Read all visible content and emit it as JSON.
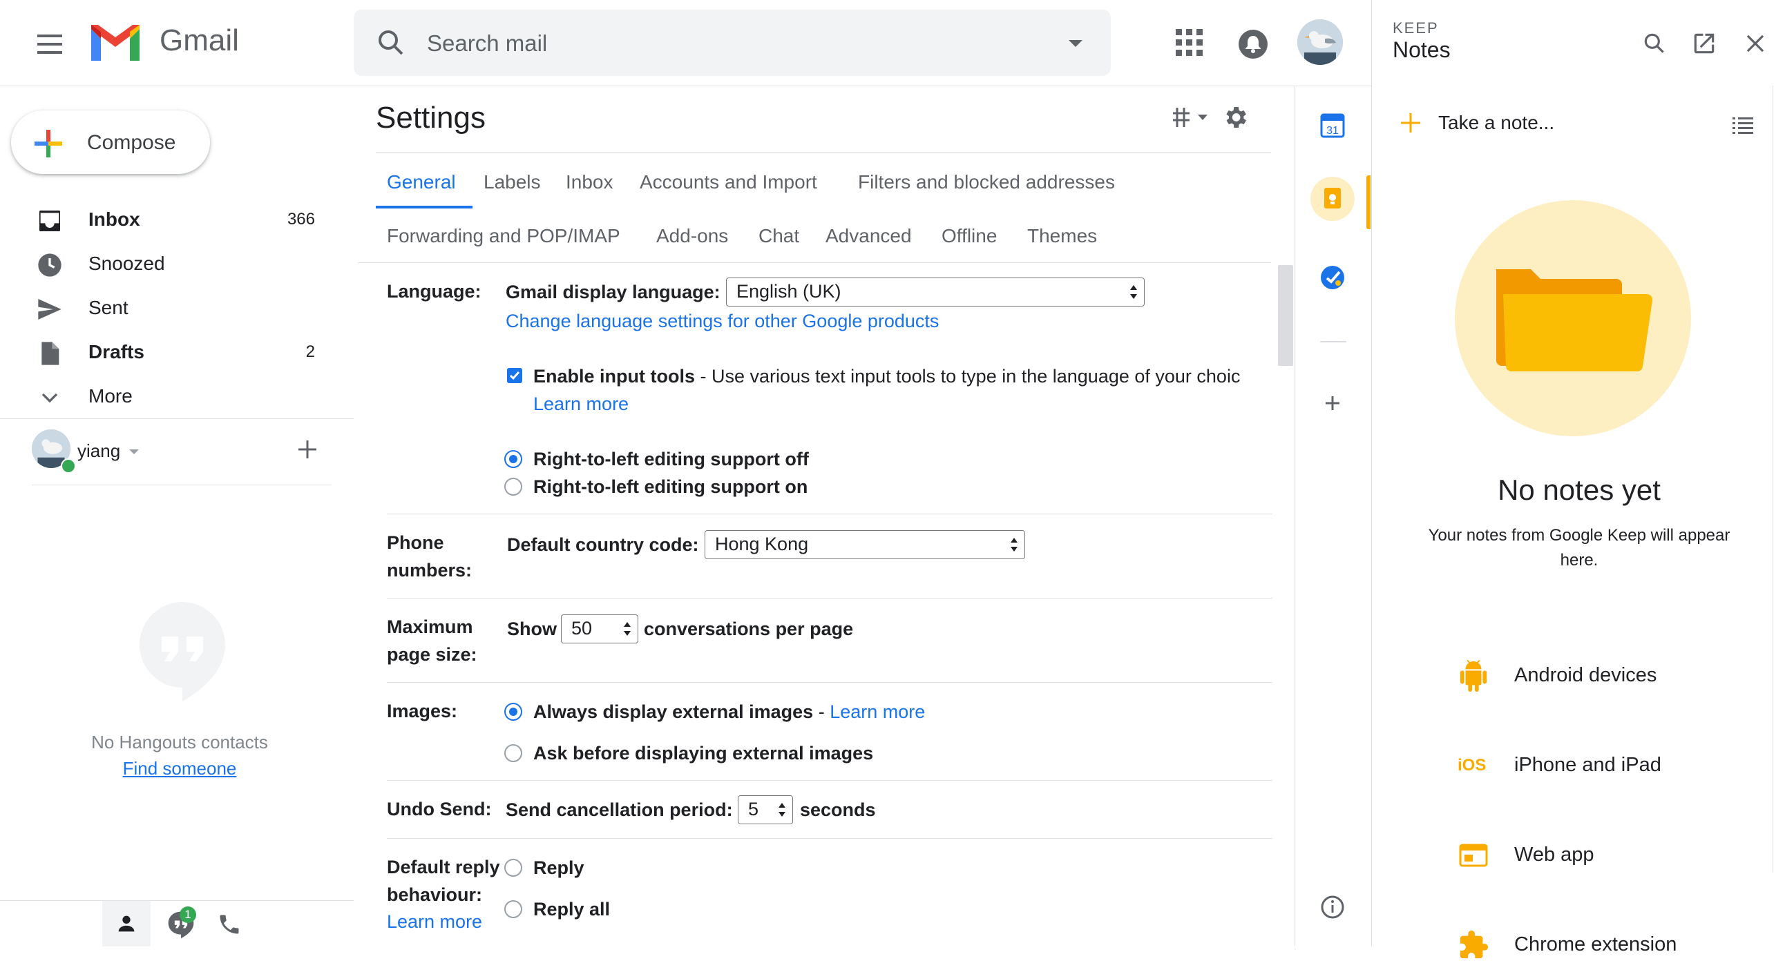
{
  "header": {
    "app_name": "Gmail",
    "search_placeholder": "Search mail"
  },
  "nav": {
    "compose_label": "Compose",
    "items": [
      {
        "label": "Inbox",
        "count": "366",
        "bold": true,
        "icon": "inbox-icon"
      },
      {
        "label": "Snoozed",
        "count": "",
        "bold": false,
        "icon": "clock-icon"
      },
      {
        "label": "Sent",
        "count": "",
        "bold": false,
        "icon": "send-icon"
      },
      {
        "label": "Drafts",
        "count": "2",
        "bold": true,
        "icon": "draft-icon"
      },
      {
        "label": "More",
        "count": "",
        "bold": false,
        "icon": "chevron-down-icon"
      }
    ],
    "user_name": "yiang",
    "no_contacts": "No Hangouts contacts",
    "find_someone": "Find someone",
    "chat_badge": "1"
  },
  "settings": {
    "title": "Settings",
    "tabs_row1": [
      "General",
      "Labels",
      "Inbox",
      "Accounts and Import",
      "Filters and blocked addresses"
    ],
    "tabs_row2": [
      "Forwarding and POP/IMAP",
      "Add-ons",
      "Chat",
      "Advanced",
      "Offline",
      "Themes"
    ],
    "active_tab": "General",
    "language": {
      "label": "Language:",
      "display_language_label": "Gmail display language:",
      "display_language_value": "English (UK)",
      "change_link": "Change language settings for other Google products",
      "input_tools_label": "Enable input tools",
      "input_tools_desc": " - Use various text input tools to type in the language of your choic",
      "learn_more": "Learn more",
      "rtl_off": "Right-to-left editing support off",
      "rtl_on": "Right-to-left editing support on"
    },
    "phone": {
      "label_line1": "Phone",
      "label_line2": "numbers:",
      "country_code_label": "Default country code:",
      "country_code_value": "Hong Kong"
    },
    "page_size": {
      "label_line1": "Maximum",
      "label_line2": "page size:",
      "show": "Show",
      "value": "50",
      "suffix": "conversations per page"
    },
    "images": {
      "label": "Images:",
      "always": "Always display external images",
      "dash": " - ",
      "learn_more": "Learn more",
      "ask": "Ask before displaying external images"
    },
    "undo_send": {
      "label": "Undo Send:",
      "period_label": "Send cancellation period:",
      "value": "5",
      "suffix": "seconds"
    },
    "reply": {
      "label_line1": "Default reply",
      "label_line2": "behaviour:",
      "learn_more": "Learn more",
      "reply": "Reply",
      "reply_all": "Reply all"
    }
  },
  "rail": {
    "calendar_day": "31"
  },
  "keep": {
    "brand": "KEEP",
    "title": "Notes",
    "take_note": "Take a note...",
    "empty_title": "No notes yet",
    "empty_subtitle": "Your notes from Google Keep will appear here.",
    "ios_badge": "iOS",
    "links": [
      {
        "label": "Android devices",
        "icon": "android-icon"
      },
      {
        "label": "iPhone and iPad",
        "icon": "ios-icon"
      },
      {
        "label": "Web app",
        "icon": "web-app-icon"
      },
      {
        "label": "Chrome extension",
        "icon": "puzzle-icon"
      }
    ]
  },
  "colors": {
    "accent": "#1a73e8",
    "keep_yellow": "#f9ab00",
    "keep_bg": "#feefc3",
    "online_green": "#34a853"
  }
}
